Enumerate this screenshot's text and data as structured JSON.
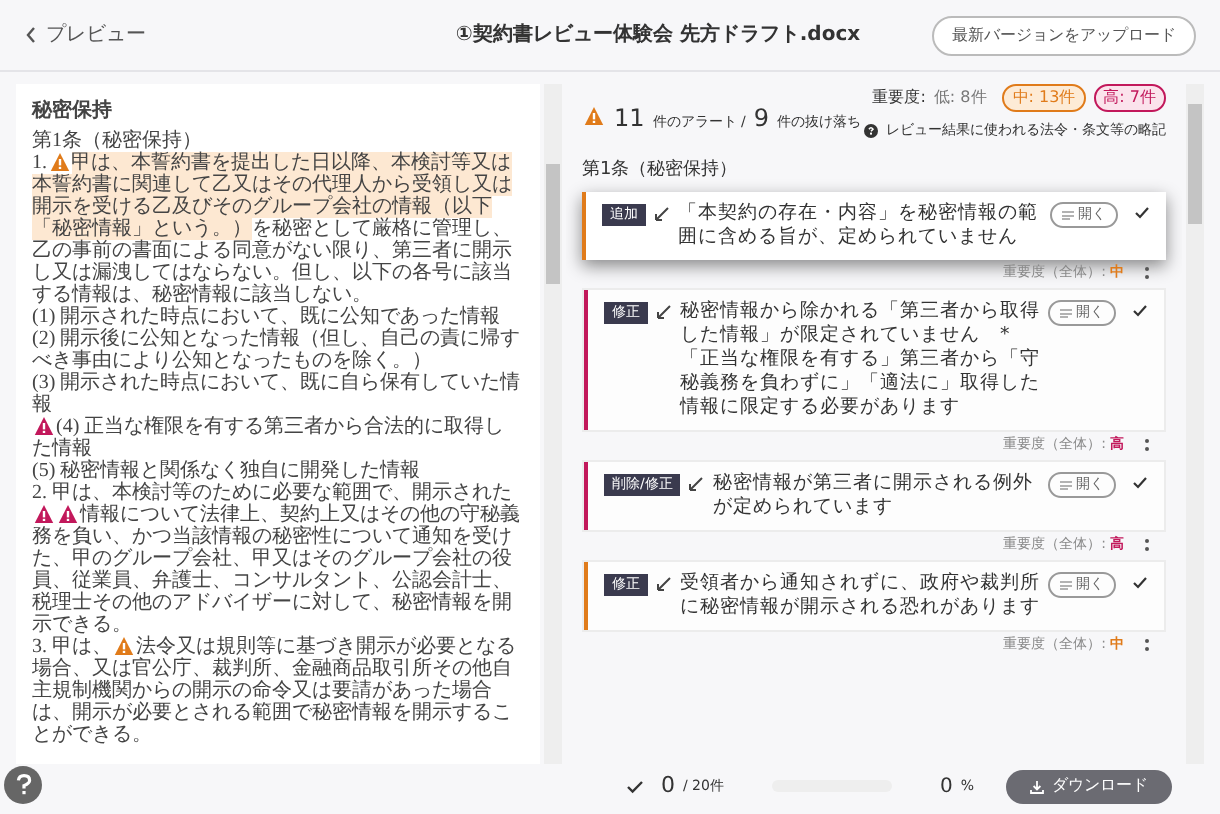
{
  "header": {
    "back": "プレビュー",
    "title": "①契約書レビュー体験会 先方ドラフト.docx",
    "upload_button": "最新バージョンをアップロード"
  },
  "document": {
    "heading": "秘密保持",
    "paragraphs": [
      [
        {
          "kind": "text",
          "text": "第1条（秘密保持）"
        }
      ],
      [
        {
          "kind": "text",
          "text": "1."
        },
        {
          "kind": "alert",
          "color": "#e07b1a"
        },
        {
          "kind": "highlight",
          "text": "甲は、本誓約書を提出した日以降、本検討等又は本誓約書に関連して乙又はその代理人から受領し又は開示を受ける乙及びそのグループ会社の情報（以下「秘密情報」という。）"
        },
        {
          "kind": "text",
          "text": "を秘密として厳格に管理し、乙の事前の書面による同意がない限り、第三者に開示し又は漏洩してはならない。但し、以下の各号に該当する情報は、秘密情報に該当しない。"
        }
      ],
      [
        {
          "kind": "text",
          "text": "(1) 開示された時点において、既に公知であった情報"
        }
      ],
      [
        {
          "kind": "text",
          "text": "(2) 開示後に公知となった情報（但し、自己の責に帰すべき事由により公知となったものを除く。）"
        }
      ],
      [
        {
          "kind": "text",
          "text": "(3) 開示された時点において、既に自ら保有していた情報"
        }
      ],
      [
        {
          "kind": "alert",
          "color": "#c2185b"
        },
        {
          "kind": "text",
          "text": "(4) 正当な権限を有する第三者から合法的に取得した情報"
        }
      ],
      [
        {
          "kind": "text",
          "text": "(5) 秘密情報と関係なく独自に開発した情報"
        }
      ],
      [
        {
          "kind": "text",
          "text": "2. 甲は、本検討等のために必要な範囲で、開示された"
        },
        {
          "kind": "alert",
          "color": "#c2185b"
        },
        {
          "kind": "alert",
          "color": "#c2185b"
        },
        {
          "kind": "text",
          "text": "情報について法律上、契約上又はその他の守秘義務を負い、かつ当該情報の秘密性について通知を受けた、甲のグループ会社、甲又はそのグループ会社の役員、従業員、弁護士、コンサルタント、公認会計士、税理士その他のアドバイザーに対して、秘密情報を開示できる。"
        }
      ],
      [
        {
          "kind": "text",
          "text": "3. 甲は、"
        },
        {
          "kind": "alert",
          "color": "#e07b1a"
        },
        {
          "kind": "text",
          "text": "法令又は規則等に基づき開示が必要となる場合、又は官公庁、裁判所、金融商品取引所その他自主規制機関からの開示の命令又は要請があった場合は、開示が必要とされる範囲で秘密情報を開示することができる。"
        }
      ]
    ]
  },
  "summary": {
    "alert_count": "11",
    "alert_label": "件のアラート /",
    "missing_count": "9",
    "missing_label": "件の抜け落ち",
    "severity_label": "重要度:",
    "low": "低: 8件",
    "medium": "中: 13件",
    "high": "高: 7件",
    "legend_link": "レビュー結果に使われる法令・条文等の略記"
  },
  "section": "第1条（秘密保持）",
  "cards": [
    {
      "tag": "追加",
      "text": "「本契約の存在・内容」を秘密情報の範囲に含める旨が、定められていません",
      "open": "開く",
      "severity_label": "重要度（全体）:",
      "severity": "中",
      "color": "#e07b1a",
      "selected": true
    },
    {
      "tag": "修正",
      "text": "秘密情報から除かれる「第三者から取得した情報」が限定されていません　*「正当な権限を有する」第三者から「守秘義務を負わずに」「適法に」取得した情報に限定する必要があります",
      "open": "開く",
      "severity_label": "重要度（全体）:",
      "severity": "高",
      "color": "#c2185b",
      "selected": false
    },
    {
      "tag": "削除/修正",
      "text": "秘密情報が第三者に開示される例外が定められています",
      "open": "開く",
      "severity_label": "重要度（全体）:",
      "severity": "高",
      "color": "#c2185b",
      "selected": false
    },
    {
      "tag": "修正",
      "text": "受領者から通知されずに、政府や裁判所に秘密情報が開示される恐れがあります",
      "open": "開く",
      "severity_label": "重要度（全体）:",
      "severity": "中",
      "color": "#e07b1a",
      "selected": false
    }
  ],
  "footer": {
    "done": "0",
    "total": "/ 20件",
    "progress": {
      "level": 0
    },
    "percent": "0",
    "percent_unit": "%",
    "download": "ダウンロード"
  }
}
